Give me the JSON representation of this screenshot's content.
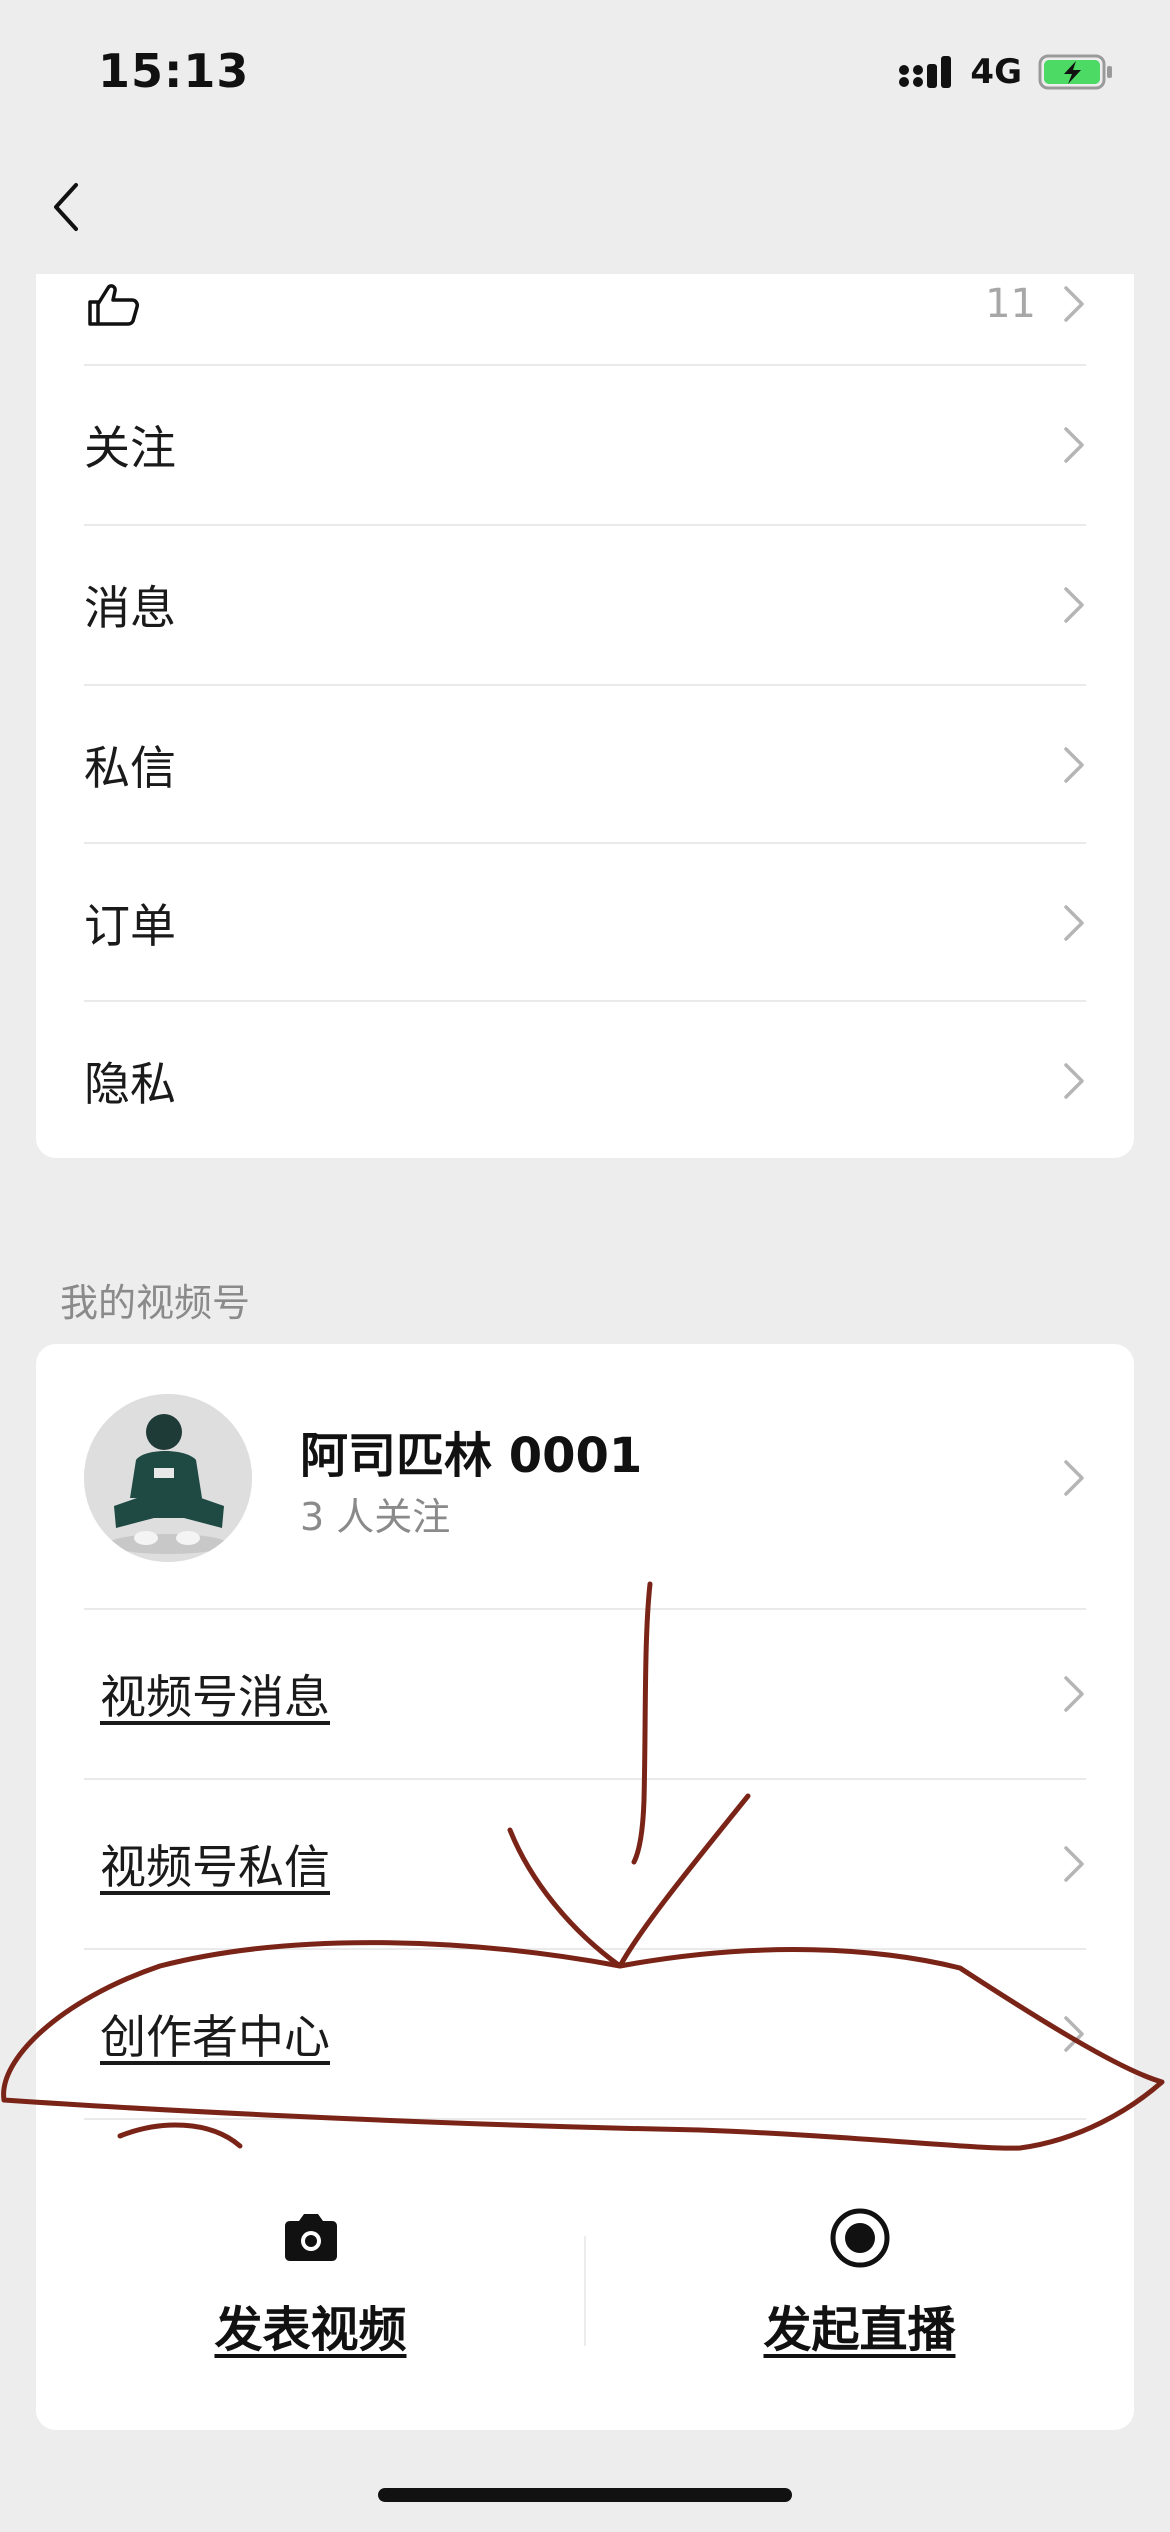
{
  "status_bar": {
    "time": "15:13",
    "network": "4G",
    "icons": [
      "signal-icon",
      "battery-charging-icon"
    ]
  },
  "nav": {
    "back_icon": "chevron-left-icon"
  },
  "settings_list": {
    "top_row_count": "11",
    "top_row_icon": "thumbs-up-icon",
    "items": [
      {
        "label": "关注"
      },
      {
        "label": "消息"
      },
      {
        "label": "私信"
      },
      {
        "label": "订单"
      },
      {
        "label": "隐私"
      }
    ]
  },
  "channel_section": {
    "title": "我的视频号",
    "profile": {
      "name": "阿司匹林 0001",
      "followers": "3 人关注"
    },
    "links": [
      {
        "label": "视频号消息"
      },
      {
        "label": "视频号私信"
      },
      {
        "label": "创作者中心"
      }
    ],
    "actions": {
      "publish_label": "发表视频",
      "publish_icon": "camera-icon",
      "live_label": "发起直播",
      "live_icon": "record-icon"
    }
  },
  "colors": {
    "background": "#ededed",
    "card": "#ffffff",
    "annotation": "#7a2418",
    "battery": "#4cd964"
  }
}
